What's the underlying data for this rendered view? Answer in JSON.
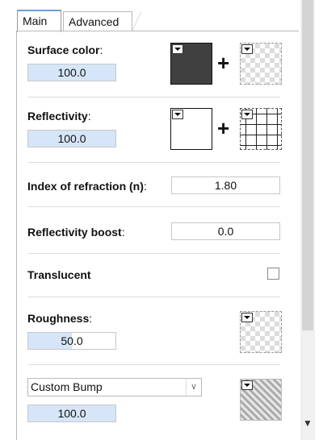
{
  "tabs": [
    {
      "label": "Main",
      "active": true
    },
    {
      "label": "Advanced",
      "active": false
    }
  ],
  "surface_color": {
    "label": "Surface color",
    "colon": ":",
    "value": "100.0",
    "value_fraction": 1.0
  },
  "reflectivity": {
    "label": "Reflectivity",
    "colon": ":",
    "value": "100.0",
    "value_fraction": 1.0
  },
  "index_of_refraction": {
    "label": "Index of refraction (n)",
    "colon": ":",
    "value": "1.80"
  },
  "reflectivity_boost": {
    "label": "Reflectivity boost",
    "colon": ":",
    "value": "0.0"
  },
  "translucent": {
    "label": "Translucent",
    "checked": false
  },
  "roughness": {
    "label": "Roughness",
    "colon": ":",
    "value": "50.0",
    "value_fraction": 0.5
  },
  "bump": {
    "selected": "Custom Bump",
    "value": "100.0",
    "value_fraction": 1.0
  },
  "plus_symbol": "+",
  "colors": {
    "accent_fill": "#d6e5f7",
    "tab_accent": "#6fa0d8",
    "surface_swatch": "#404040",
    "reflectivity_swatch": "#ffffff"
  },
  "icons": [
    "dropdown-arrow-icon",
    "plus-icon",
    "checker-texture-icon",
    "chevron-down-icon"
  ]
}
